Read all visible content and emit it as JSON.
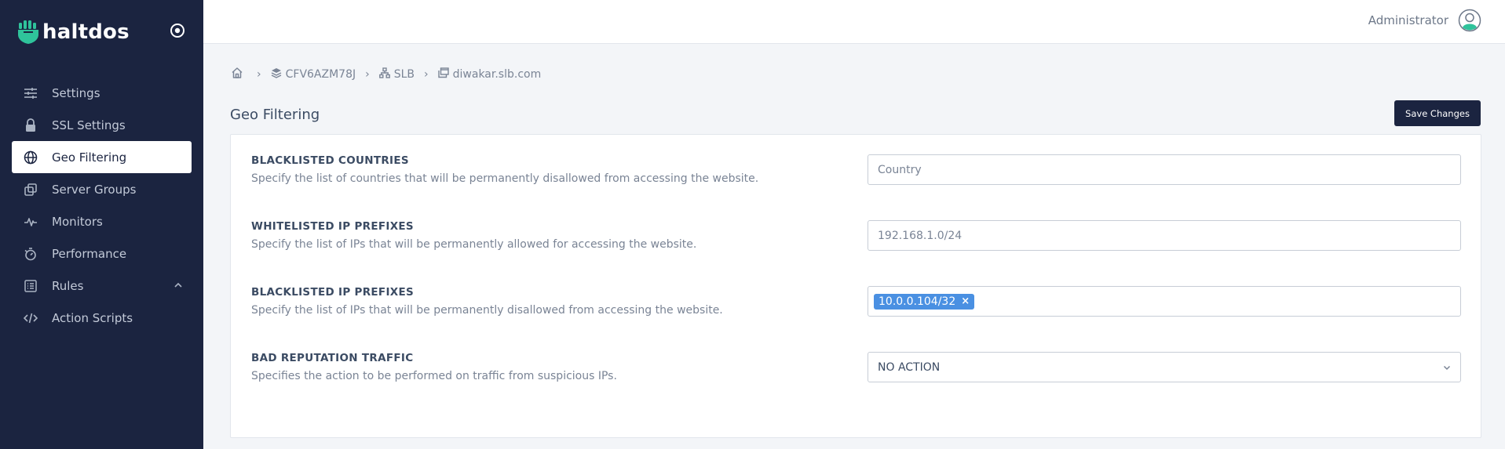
{
  "sidebar": {
    "brand_name": "haltdos",
    "items": [
      {
        "label": "Settings",
        "icon": "sliders-icon"
      },
      {
        "label": "SSL Settings",
        "icon": "lock-icon"
      },
      {
        "label": "Geo Filtering",
        "icon": "globe-icon",
        "active": true
      },
      {
        "label": "Server Groups",
        "icon": "copy-icon"
      },
      {
        "label": "Monitors",
        "icon": "activity-icon"
      },
      {
        "label": "Performance",
        "icon": "stopwatch-icon"
      },
      {
        "label": "Rules",
        "icon": "list-icon",
        "expandable": true
      },
      {
        "label": "Action Scripts",
        "icon": "code-icon"
      }
    ]
  },
  "header": {
    "user_name": "Administrator"
  },
  "breadcrumb": {
    "items": [
      "CFV6AZM78J",
      "SLB",
      "diwakar.slb.com"
    ]
  },
  "page": {
    "title": "Geo Filtering",
    "save_label": "Save Changes"
  },
  "form": {
    "blacklisted_countries": {
      "label": "BLACKLISTED COUNTRIES",
      "description": "Specify the list of countries that will be permanently disallowed from accessing the website.",
      "placeholder": "Country"
    },
    "whitelisted_ip": {
      "label": "WHITELISTED IP PREFIXES",
      "description": "Specify the list of IPs that will be permanently allowed for accessing the website.",
      "placeholder": "192.168.1.0/24"
    },
    "blacklisted_ip": {
      "label": "BLACKLISTED IP PREFIXES",
      "description": "Specify the list of IPs that will be permanently disallowed from accessing the website.",
      "tags": [
        "10.0.0.104/32"
      ],
      "tag_remove": "×"
    },
    "bad_reputation": {
      "label": "BAD REPUTATION TRAFFIC",
      "description": "Specifies the action to be performed on traffic from suspicious IPs.",
      "value": "NO ACTION"
    }
  },
  "colors": {
    "sidebar_bg": "#1b2440",
    "accent": "#4a90e2",
    "brand_green": "#2fc39b"
  }
}
